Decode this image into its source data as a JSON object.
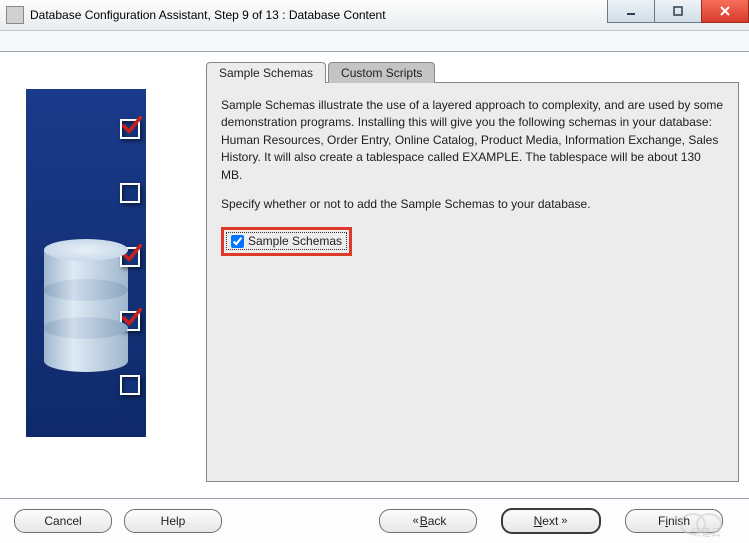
{
  "window": {
    "title": "Database Configuration Assistant, Step 9 of 13 : Database Content"
  },
  "tabs": {
    "sample": "Sample Schemas",
    "custom": "Custom Scripts"
  },
  "body": {
    "p1": "Sample Schemas illustrate the use of a layered approach to complexity, and are used by some demonstration programs. Installing this will give you the following schemas in your database: Human Resources, Order Entry, Online Catalog, Product Media, Information Exchange, Sales History. It will also create a tablespace called EXAMPLE. The tablespace will be about 130 MB.",
    "p2": "Specify whether or not to add the Sample Schemas to your database.",
    "checkbox_label": "Sample Schemas"
  },
  "buttons": {
    "cancel": "Cancel",
    "help": "Help",
    "back_arrow": "⟨⟨",
    "back": "Back",
    "next": "Next",
    "next_arrow": "⟩⟩",
    "finish": "Finish"
  },
  "side_checks": [
    {
      "checked": true
    },
    {
      "checked": false
    },
    {
      "checked": true
    },
    {
      "checked": true
    },
    {
      "checked": false
    }
  ],
  "watermark": "亿速云"
}
